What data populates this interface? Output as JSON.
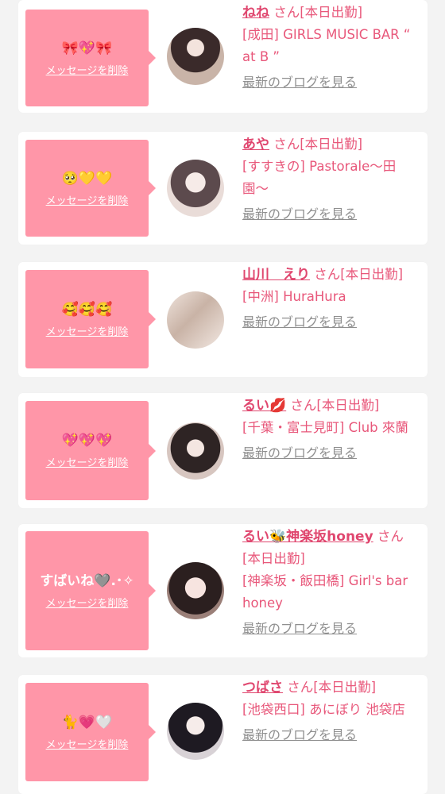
{
  "entries": [
    {
      "message": "🎀💖🎀",
      "delete_label": "メッセージを削除",
      "name": "ねね",
      "honorific": "さん",
      "status": "[本日出勤]",
      "shop": "[成田] GIRLS MUSIC BAR “ at B ”",
      "blog_label": "最新のブログを見る",
      "avatar": "avatar-photo"
    },
    {
      "message": "🥺💛💛",
      "delete_label": "メッセージを削除",
      "name": "あや",
      "honorific": "さん",
      "status": "[本日出勤]",
      "shop": "[すすきの] Pastorale〜田園〜",
      "blog_label": "最新のブログを見る",
      "avatar": "avatar-photo"
    },
    {
      "message": "🥰🥰🥰",
      "delete_label": "メッセージを削除",
      "name": "山川　えり",
      "honorific": "さん",
      "status": "[本日出勤]",
      "shop": "[中洲] HuraHura",
      "blog_label": "最新のブログを見る",
      "avatar": "avatar-photo"
    },
    {
      "message": "💖💖💖",
      "delete_label": "メッセージを削除",
      "name": "るい💋",
      "honorific": "さん",
      "status": "[本日出勤]",
      "shop": "[千葉・富士見町] Club 來蘭",
      "blog_label": "最新のブログを見る",
      "avatar": "avatar-photo"
    },
    {
      "message": "すばいね🩶.･✧",
      "delete_label": "メッセージを削除",
      "name": "るい🐝神楽坂honey",
      "honorific": "さん",
      "status": "[本日出勤]",
      "shop": "[神楽坂・飯田橋] Girl's bar honey",
      "blog_label": "最新のブログを見る",
      "avatar": "avatar-photo"
    },
    {
      "message": "🐈💗🤍",
      "delete_label": "メッセージを削除",
      "name": "つばさ",
      "honorific": "さん",
      "status": "[本日出勤]",
      "shop": "[池袋西口] あにぼり 池袋店",
      "blog_label": "最新のブログを見る",
      "avatar": "avatar-photo"
    }
  ],
  "colors": {
    "accent_pink": "#ff96a8",
    "name_pink": "#e0476f",
    "text_pink": "#e8577a",
    "link_gray": "#8f8f8f"
  }
}
